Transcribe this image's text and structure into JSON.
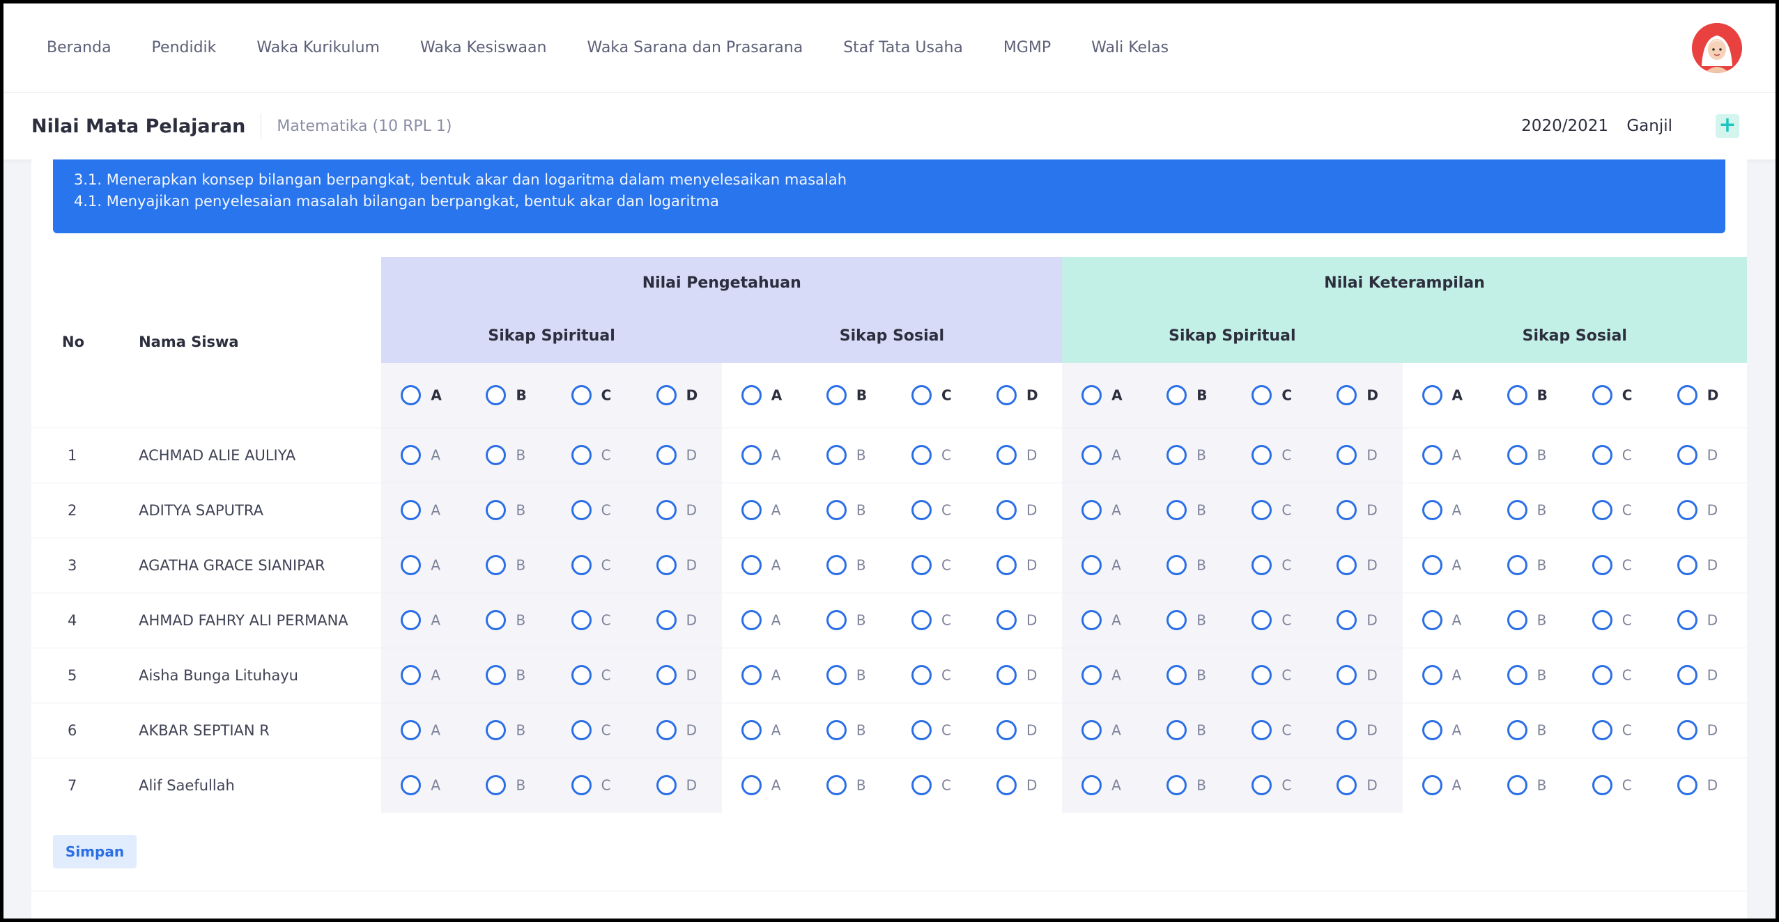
{
  "nav": {
    "items": [
      "Beranda",
      "Pendidik",
      "Waka Kurikulum",
      "Waka Kesiswaan",
      "Waka Sarana dan Prasarana",
      "Staf Tata Usaha",
      "MGMP",
      "Wali Kelas"
    ]
  },
  "header": {
    "title": "Nilai Mata Pelajaran",
    "subject": "Matematika (10 RPL 1)",
    "year": "2020/2021",
    "semester": "Ganjil",
    "add_label": "+"
  },
  "kd": [
    "3.1. Menerapkan konsep bilangan berpangkat, bentuk akar dan logaritma dalam menyelesaikan masalah",
    "4.1. Menyajikan penyelesaian masalah bilangan berpangkat, bentuk akar dan logaritma"
  ],
  "table": {
    "col_no": "No",
    "col_name": "Nama Siswa",
    "group_pengetahuan": "Nilai Pengetahuan",
    "group_keterampilan": "Nilai Keterampilan",
    "sub_spiritual": "Sikap Spiritual",
    "sub_sosial": "Sikap Sosial",
    "options": [
      "A",
      "B",
      "C",
      "D"
    ],
    "rows": [
      {
        "no": "1",
        "name": "ACHMAD ALIE AULIYA"
      },
      {
        "no": "2",
        "name": "ADITYA SAPUTRA"
      },
      {
        "no": "3",
        "name": "AGATHA GRACE SIANIPAR"
      },
      {
        "no": "4",
        "name": "AHMAD FAHRY ALI PERMANA"
      },
      {
        "no": "5",
        "name": "Aisha Bunga Lituhayu"
      },
      {
        "no": "6",
        "name": "AKBAR SEPTIAN R"
      },
      {
        "no": "7",
        "name": "Alif Saefullah"
      }
    ]
  },
  "save_label": "Simpan",
  "colors": {
    "accent": "#2875ed",
    "pengetahuan_header": "#d7dbf7",
    "keterampilan_header": "#c3f0e6",
    "radio_border": "#2b6fe6"
  }
}
